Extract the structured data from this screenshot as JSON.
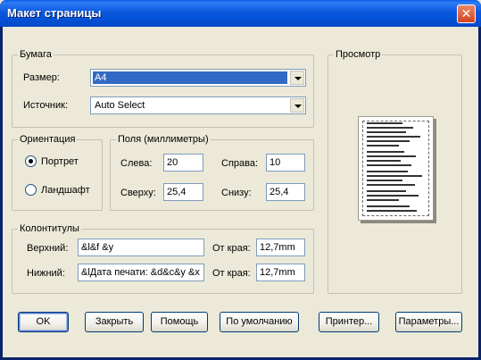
{
  "window": {
    "title": "Макет страницы",
    "close_glyph": "✕"
  },
  "paper": {
    "group_label": "Бумага",
    "size_label": "Размер:",
    "size_value": "A4",
    "source_label": "Источник:",
    "source_value": "Auto Select"
  },
  "orientation": {
    "group_label": "Ориентация",
    "portrait": "Портрет",
    "landscape": "Ландшафт",
    "selected": "portrait"
  },
  "margins": {
    "group_label": "Поля (миллиметры)",
    "left_label": "Слева:",
    "left_value": "20",
    "right_label": "Справа:",
    "right_value": "10",
    "top_label": "Сверху:",
    "top_value": "25,4",
    "bottom_label": "Снизу:",
    "bottom_value": "25,4"
  },
  "headers": {
    "group_label": "Колонтитулы",
    "header_label": "Верхний:",
    "header_value": "&l&f &y",
    "footer_label": "Нижний:",
    "footer_value": "&lДата печати: &d&c&y &x",
    "header_offset_label": "От края:",
    "header_offset_value": "12,7mm",
    "footer_offset_label": "От края:",
    "footer_offset_value": "12,7mm"
  },
  "preview": {
    "group_label": "Просмотр"
  },
  "buttons": {
    "ok": "OK",
    "close": "Закрыть",
    "help": "Помощь",
    "default": "По умолчанию",
    "printer": "Принтер...",
    "settings": "Параметры..."
  },
  "icons": {
    "close": "close-icon",
    "dropdown": "chevron-down-icon"
  }
}
